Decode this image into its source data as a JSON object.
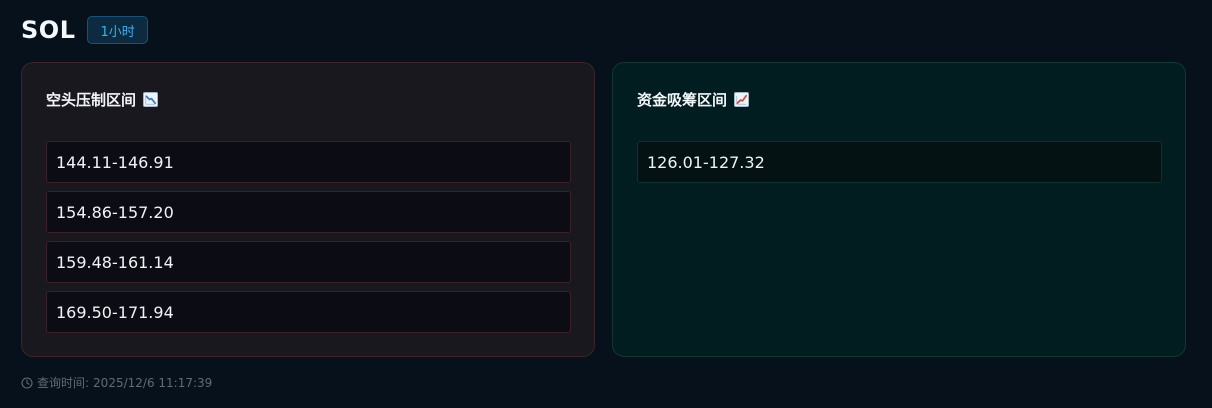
{
  "header": {
    "symbol": "SOL",
    "timeframe": "1小时"
  },
  "short_panel": {
    "title": "空头压制区间",
    "icon": "chart-decreasing-icon",
    "ranges": [
      "144.11-146.91",
      "154.86-157.20",
      "159.48-161.14",
      "169.50-171.94"
    ]
  },
  "accum_panel": {
    "title": "资金吸筹区间",
    "icon": "chart-increasing-icon",
    "ranges": [
      "126.01-127.32"
    ]
  },
  "footer": {
    "label": "查询时间:",
    "time": "2025/12/6 11:17:39"
  },
  "colors": {
    "background": "#06111b",
    "badge_text": "#3ab0ee",
    "short_panel_bg": "#19181f",
    "accum_panel_bg": "#011d1f"
  }
}
